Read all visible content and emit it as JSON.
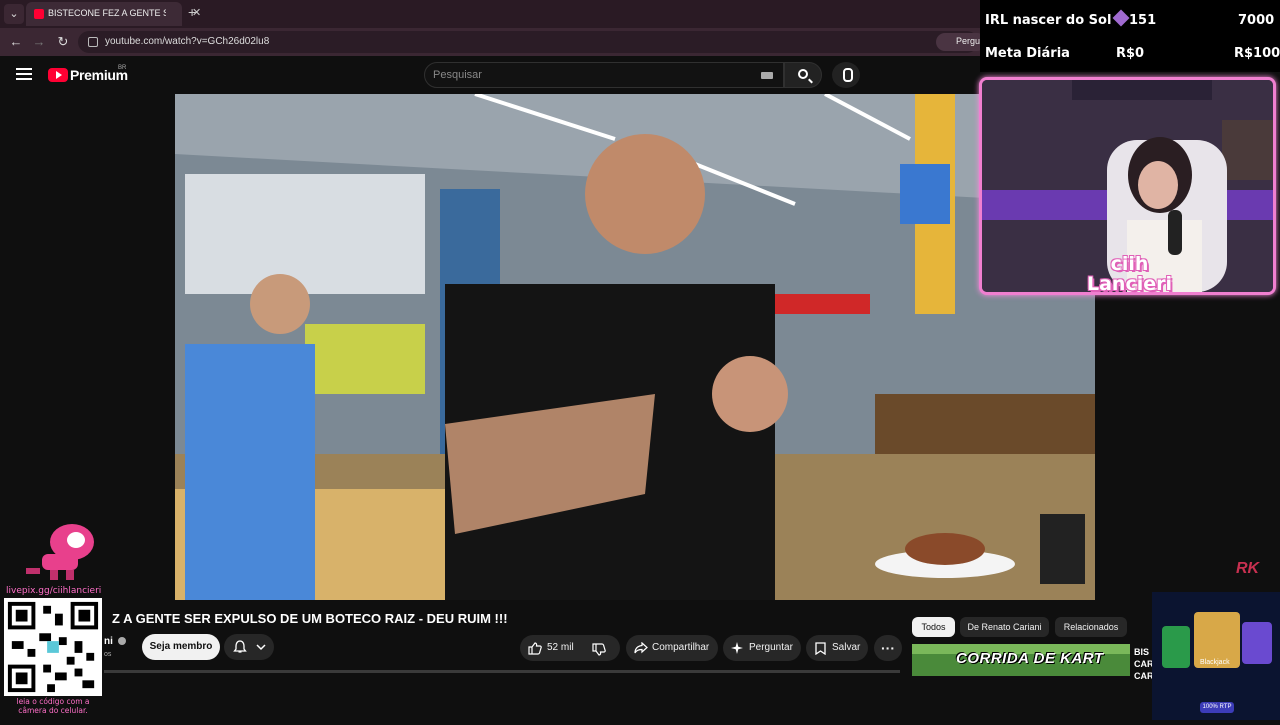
{
  "browser": {
    "tab_title": "BISTECONE FEZ A GENTE SER",
    "url": "youtube.com/watch?v=GCh26d02lu8",
    "ask_label": "Pergu"
  },
  "youtube": {
    "logo_text": "Premium",
    "region": "BR",
    "search_placeholder": "Pesquisar",
    "video_title": "Z A GENTE SER EXPULSO DE UM BOTECO RAIZ - DEU RUIM !!!",
    "channel_name": "ni",
    "channel_subs": "os",
    "member_button": "Seja membro",
    "likes": "52 mil",
    "share_label": "Compartilhar",
    "ask_label": "Perguntar",
    "save_label": "Salvar",
    "chips": [
      "Todos",
      "De Renato Cariani",
      "Relacionados"
    ],
    "next_thumb_text": "CORRIDA DE KART",
    "next_side_line1": "BIS",
    "next_side_line2": "CAR",
    "next_side_line3": "CAR"
  },
  "stream": {
    "goal_name": "IRL nascer do Sol",
    "goal_count": "151",
    "goal_target": "7000",
    "meta_label": "Meta Diária",
    "meta_current": "R$0",
    "meta_target": "R$100",
    "streamer_name_1": "ciih",
    "streamer_name_2": "Lancieri",
    "livepix_label": "livepix.gg/ciihlancieri",
    "qr_hint": "leia o código com a câmera do celular.",
    "rk_logo": "RK",
    "ad_game": "Blackjack",
    "ad_rtp": "100% RTP"
  },
  "colors": {
    "overlay_pink": "#f07fd0",
    "yt_red": "#ff0033",
    "dark_bg": "#0f0f0f"
  }
}
